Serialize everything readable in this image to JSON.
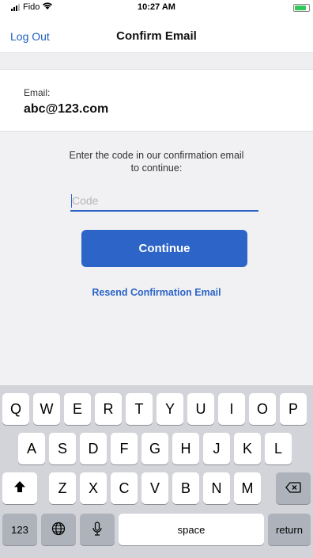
{
  "status_bar": {
    "carrier": "Fido",
    "time": "10:27 AM"
  },
  "nav": {
    "back_label": "Log Out",
    "title": "Confirm Email"
  },
  "email": {
    "label": "Email:",
    "value": "abc@123.com"
  },
  "confirm": {
    "instruction_line1": "Enter the code in our confirmation email",
    "instruction_line2": "to continue:",
    "code_placeholder": "Code",
    "code_value": "",
    "continue_label": "Continue",
    "resend_label": "Resend Confirmation Email"
  },
  "keyboard": {
    "row1": [
      "Q",
      "W",
      "E",
      "R",
      "T",
      "Y",
      "U",
      "I",
      "O",
      "P"
    ],
    "row2": [
      "A",
      "S",
      "D",
      "F",
      "G",
      "H",
      "J",
      "K",
      "L"
    ],
    "row3": [
      "Z",
      "X",
      "C",
      "V",
      "B",
      "N",
      "M"
    ],
    "numbers_label": "123",
    "space_label": "space",
    "return_label": "return",
    "icons": {
      "shift": "shift-icon",
      "delete": "backspace-icon",
      "globe": "globe-icon",
      "mic": "microphone-icon"
    }
  },
  "colors": {
    "accent": "#2d64c8",
    "background_grey": "#f1f1f3",
    "keyboard_bg": "#d2d4d9"
  }
}
